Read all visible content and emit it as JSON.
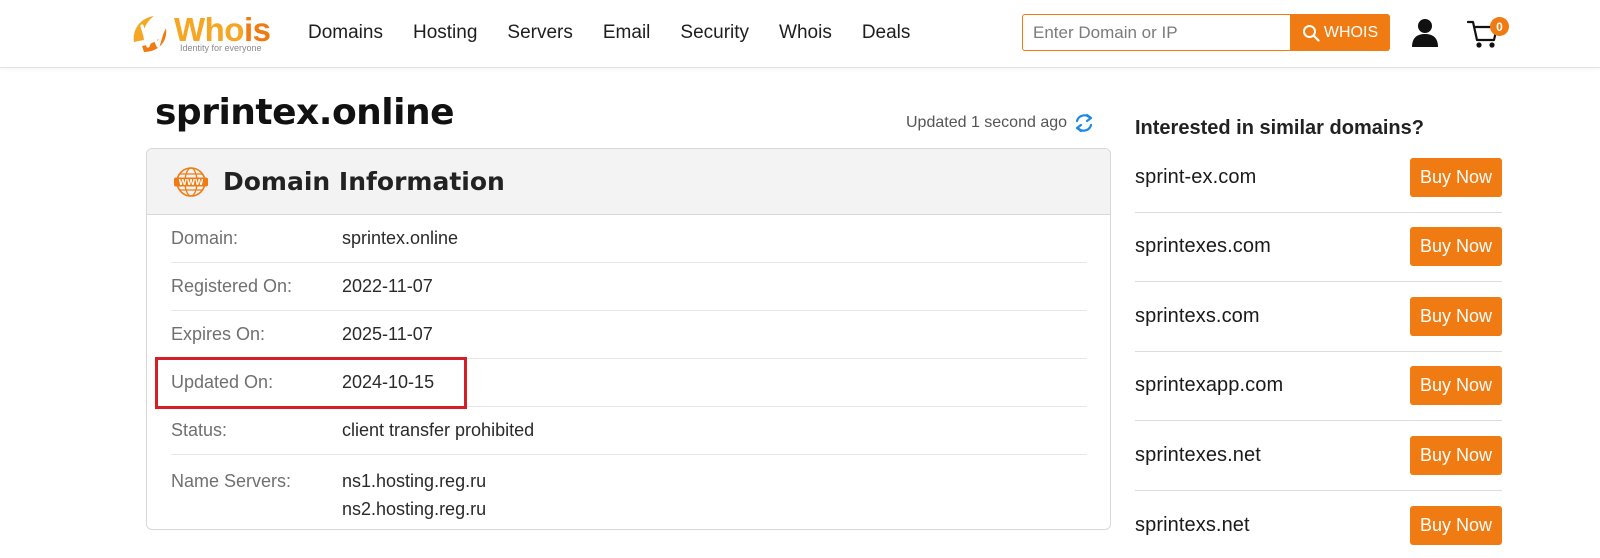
{
  "brand": {
    "name_main": "Who",
    "name_accent": "is",
    "tagline": "Identity for everyone",
    "primary_color": "#f07b12",
    "logo_icon": "whois-logo-icon"
  },
  "nav": {
    "items": [
      "Domains",
      "Hosting",
      "Servers",
      "Email",
      "Security",
      "Whois",
      "Deals"
    ]
  },
  "search": {
    "placeholder": "Enter Domain or IP",
    "value": "",
    "button_label": "WHOIS",
    "button_icon": "search-icon"
  },
  "header_icons": {
    "user": "user-icon",
    "cart": "cart-icon",
    "cart_count": "0"
  },
  "page": {
    "title": "sprintex.online",
    "updated_note": "Updated 1 second ago",
    "refresh_icon": "refresh-icon"
  },
  "domain_info": {
    "heading": "Domain Information",
    "heading_icon": "www-icon",
    "rows": [
      {
        "label": "Domain:",
        "value": "sprintex.online"
      },
      {
        "label": "Registered On:",
        "value": "2022-11-07"
      },
      {
        "label": "Expires On:",
        "value": "2025-11-07"
      },
      {
        "label": "Updated On:",
        "value": "2024-10-15"
      },
      {
        "label": "Status:",
        "value": "client transfer prohibited"
      }
    ],
    "name_servers": {
      "label": "Name Servers:",
      "values": [
        "ns1.hosting.reg.ru",
        "ns2.hosting.reg.ru"
      ]
    },
    "highlight_color": "#d51f26"
  },
  "similar": {
    "heading": "Interested in similar domains?",
    "button_label": "Buy Now",
    "domains": [
      "sprint-ex.com",
      "sprintexes.com",
      "sprintexs.com",
      "sprintexapp.com",
      "sprintexes.net",
      "sprintexs.net"
    ]
  }
}
